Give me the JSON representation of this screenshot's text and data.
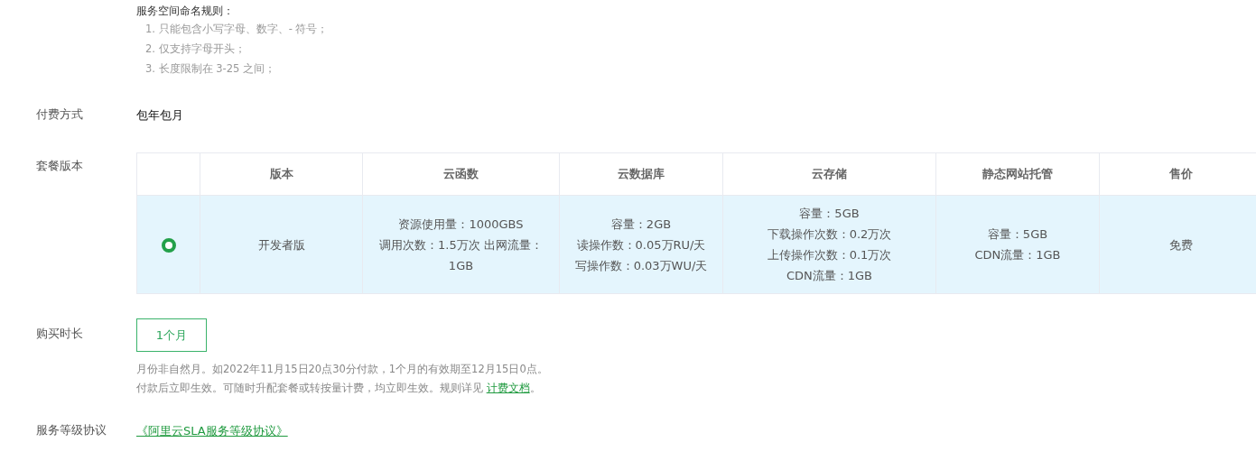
{
  "naming_rules": {
    "title": "服务空间命名规则：",
    "items": [
      "1. 只能包含小写字母、数字、- 符号；",
      "2. 仅支持字母开头；",
      "3. 长度限制在 3-25 之间；"
    ]
  },
  "payment": {
    "label": "付费方式",
    "value": "包年包月"
  },
  "plan": {
    "label": "套餐版本",
    "columns": [
      "版本",
      "云函数",
      "云数据库",
      "云存储",
      "静态网站托管",
      "售价"
    ],
    "rows": [
      {
        "selected": true,
        "cells": [
          [
            "开发者版"
          ],
          [
            "资源使用量：1000GBS",
            "调用次数：1.5万次 出网流量：1GB"
          ],
          [
            "容量：2GB",
            "读操作数：0.05万RU/天",
            "写操作数：0.03万WU/天"
          ],
          [
            "容量：5GB",
            "下载操作次数：0.2万次",
            "上传操作次数：0.1万次",
            "CDN流量：1GB"
          ],
          [
            "容量：5GB",
            "CDN流量：1GB"
          ],
          [
            "免费"
          ]
        ]
      }
    ]
  },
  "duration": {
    "label": "购买时长",
    "options": [
      {
        "label": "1个月",
        "selected": true
      }
    ],
    "notes": [
      {
        "text": "月份非自然月。如2022年11月15日20点30分付款，1个月的有效期至12月15日0点。"
      },
      {
        "text": "付款后立即生效。可随时升配套餐或转按量计费，均立即生效。规则详见 ",
        "link": "计费文档",
        "suffix": "。"
      }
    ]
  },
  "sla": {
    "label": "服务等级协议",
    "link": "《阿里云SLA服务等级协议》"
  }
}
